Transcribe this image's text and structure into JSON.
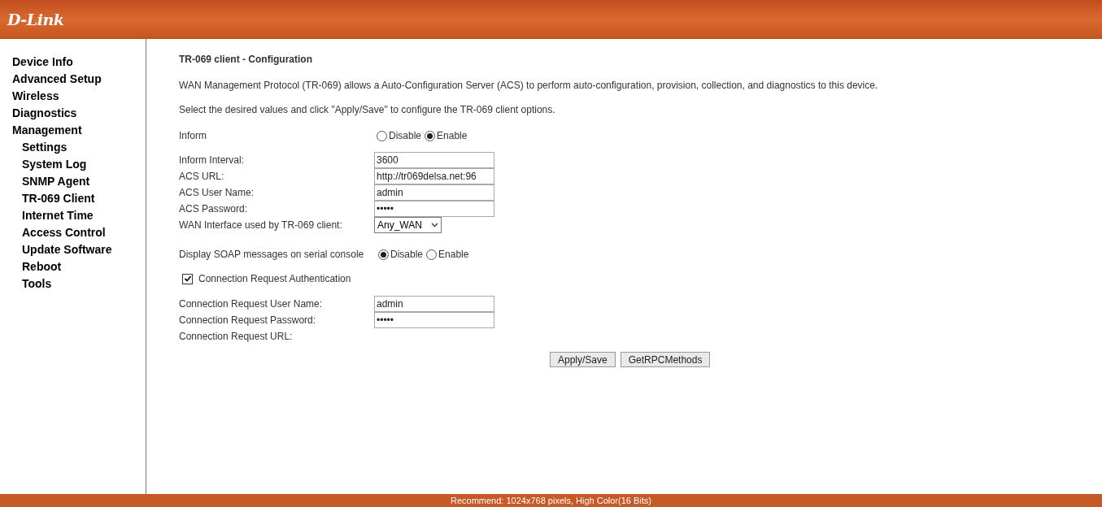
{
  "header": {
    "logo": "D-Link"
  },
  "sidebar": {
    "items": [
      {
        "label": "Device Info"
      },
      {
        "label": "Advanced Setup"
      },
      {
        "label": "Wireless"
      },
      {
        "label": "Diagnostics"
      },
      {
        "label": "Management",
        "children": [
          {
            "label": "Settings"
          },
          {
            "label": "System Log"
          },
          {
            "label": "SNMP Agent"
          },
          {
            "label": "TR-069 Client"
          },
          {
            "label": "Internet Time"
          },
          {
            "label": "Access Control"
          },
          {
            "label": "Update Software"
          },
          {
            "label": "Reboot"
          },
          {
            "label": "Tools"
          }
        ]
      }
    ]
  },
  "title": "TR-069 client - Configuration",
  "intro": [
    "WAN Management Protocol (TR-069) allows a Auto-Configuration Server (ACS) to perform auto-configuration, provision, collection, and diagnostics to this device.",
    "Select the desired values and click \"Apply/Save\" to configure the TR-069 client options."
  ],
  "inform": {
    "label": "Inform",
    "options": [
      {
        "label": "Disable",
        "selected": false
      },
      {
        "label": "Enable",
        "selected": true
      }
    ]
  },
  "fields": [
    {
      "kind": "text",
      "label": "Inform Interval:",
      "value": "3600"
    },
    {
      "kind": "text",
      "label": "ACS URL:",
      "value": "http://tr069delsa.net:96"
    },
    {
      "kind": "text",
      "label": "ACS User Name:",
      "value": "admin"
    },
    {
      "kind": "text",
      "label": "ACS Password:",
      "value": "•••••"
    },
    {
      "kind": "select",
      "label": "WAN Interface used by TR-069 client:",
      "value": "Any_WAN"
    }
  ],
  "soap": {
    "label": "Display SOAP messages on serial console",
    "options": [
      {
        "label": "Disable",
        "selected": true
      },
      {
        "label": "Enable",
        "selected": false
      }
    ]
  },
  "auth": {
    "label": "Connection Request Authentication",
    "checked": true
  },
  "conn_fields": [
    {
      "kind": "text",
      "label": "Connection Request User Name:",
      "value": "admin"
    },
    {
      "kind": "text",
      "label": "Connection Request Password:",
      "value": "•••••"
    },
    {
      "kind": "label",
      "label": "Connection Request URL:"
    }
  ],
  "buttons": [
    "Apply/Save",
    "GetRPCMethods"
  ],
  "footer": "Recommend: 1024x768 pixels, High Color(16 Bits)"
}
